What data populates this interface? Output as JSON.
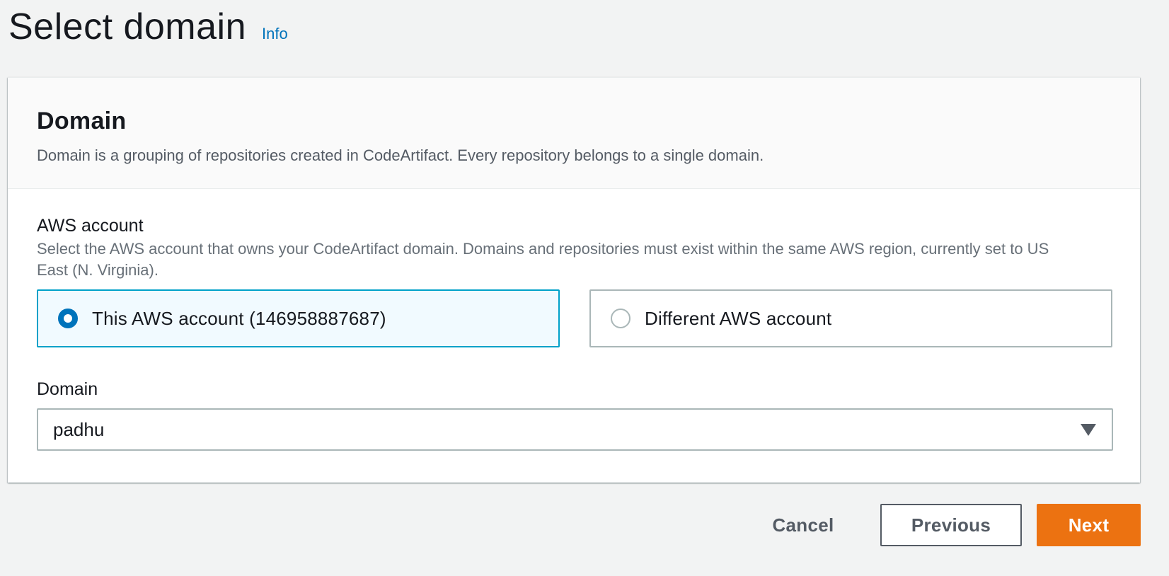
{
  "page": {
    "title": "Select domain",
    "info_link": "Info"
  },
  "container": {
    "title": "Domain",
    "description": "Domain is a grouping of repositories created in CodeArtifact. Every repository belongs to a single domain."
  },
  "aws_account": {
    "label": "AWS account",
    "description": "Select the AWS account that owns your CodeArtifact domain. Domains and repositories must exist within the same AWS region, currently set to US East (N. Virginia).",
    "options": [
      {
        "label": "This AWS account (146958887687)",
        "selected": true
      },
      {
        "label": "Different AWS account",
        "selected": false
      }
    ]
  },
  "domain": {
    "label": "Domain",
    "selected_value": "padhu"
  },
  "actions": {
    "cancel_label": "Cancel",
    "previous_label": "Previous",
    "next_label": "Next"
  },
  "colors": {
    "accent_blue": "#0073bb",
    "selected_border": "#00a1c9",
    "primary_button": "#ec7211",
    "background": "#f2f3f3"
  },
  "icons": {
    "select_caret": "caret-down-icon",
    "radio_selected": "radio-selected-icon",
    "radio_unselected": "radio-unselected-icon"
  }
}
